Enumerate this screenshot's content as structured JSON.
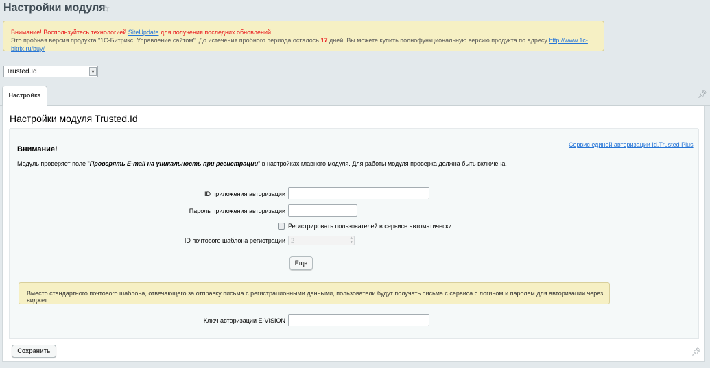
{
  "page": {
    "title": "Настройки модуля"
  },
  "notice": {
    "line1_prefix": "Внимание! Воспользуйтесь технологией ",
    "line1_link": "SiteUpdate",
    "line1_suffix": " для получения последних обновлений.",
    "line2_prefix": "Это пробная версия продукта \"1С-Битрикс: Управление сайтом\". До истечения пробного периода осталось ",
    "days": "17",
    "line2_middle": " дней. Вы можете купить полнофункциональную версию продукта по адресу ",
    "line2_link": "http://www.1c-bitrix.ru/buy/"
  },
  "module_select": {
    "value": "Trusted.Id"
  },
  "tabs": [
    {
      "label": "Настройка"
    }
  ],
  "panel": {
    "title": "Настройки модуля Trusted.Id",
    "service_link": "Сервис единой авторизации Id.Trusted Plus",
    "warning_title": "Внимание!",
    "warning_prefix": "Модуль проверяет поле \"",
    "warning_field": "Проверять E-mail на уникальность при регистрации",
    "warning_suffix": "\" в настройках главного модуля. Для работы модуля проверка должна быть включена."
  },
  "form": {
    "app_id_label": "ID приложения авторизации",
    "app_id_value": "",
    "app_password_label": "Пароль приложения авторизации",
    "app_password_value": "",
    "auto_register_label": "Регистрировать пользователей в сервисе автоматически",
    "auto_register_checked": false,
    "mail_template_label": "ID почтового шаблона регистрации",
    "mail_template_value": "2",
    "more_button": "Еще",
    "info_text": "Вместо стандартного почтового шаблона, отвечающего за отправку письма с регистрационными данными, пользователи будут получать письма с сервиса с логином и паролем для авторизации через виджет.",
    "evision_key_label": "Ключ авторизации E-VISION",
    "evision_key_value": ""
  },
  "footer": {
    "save_button": "Сохранить"
  },
  "icons": {
    "favorite": "star-icon",
    "pin": "pin-icon",
    "dropdown": "chevron-down-icon",
    "spinner": "spinner-arrows-icon"
  }
}
